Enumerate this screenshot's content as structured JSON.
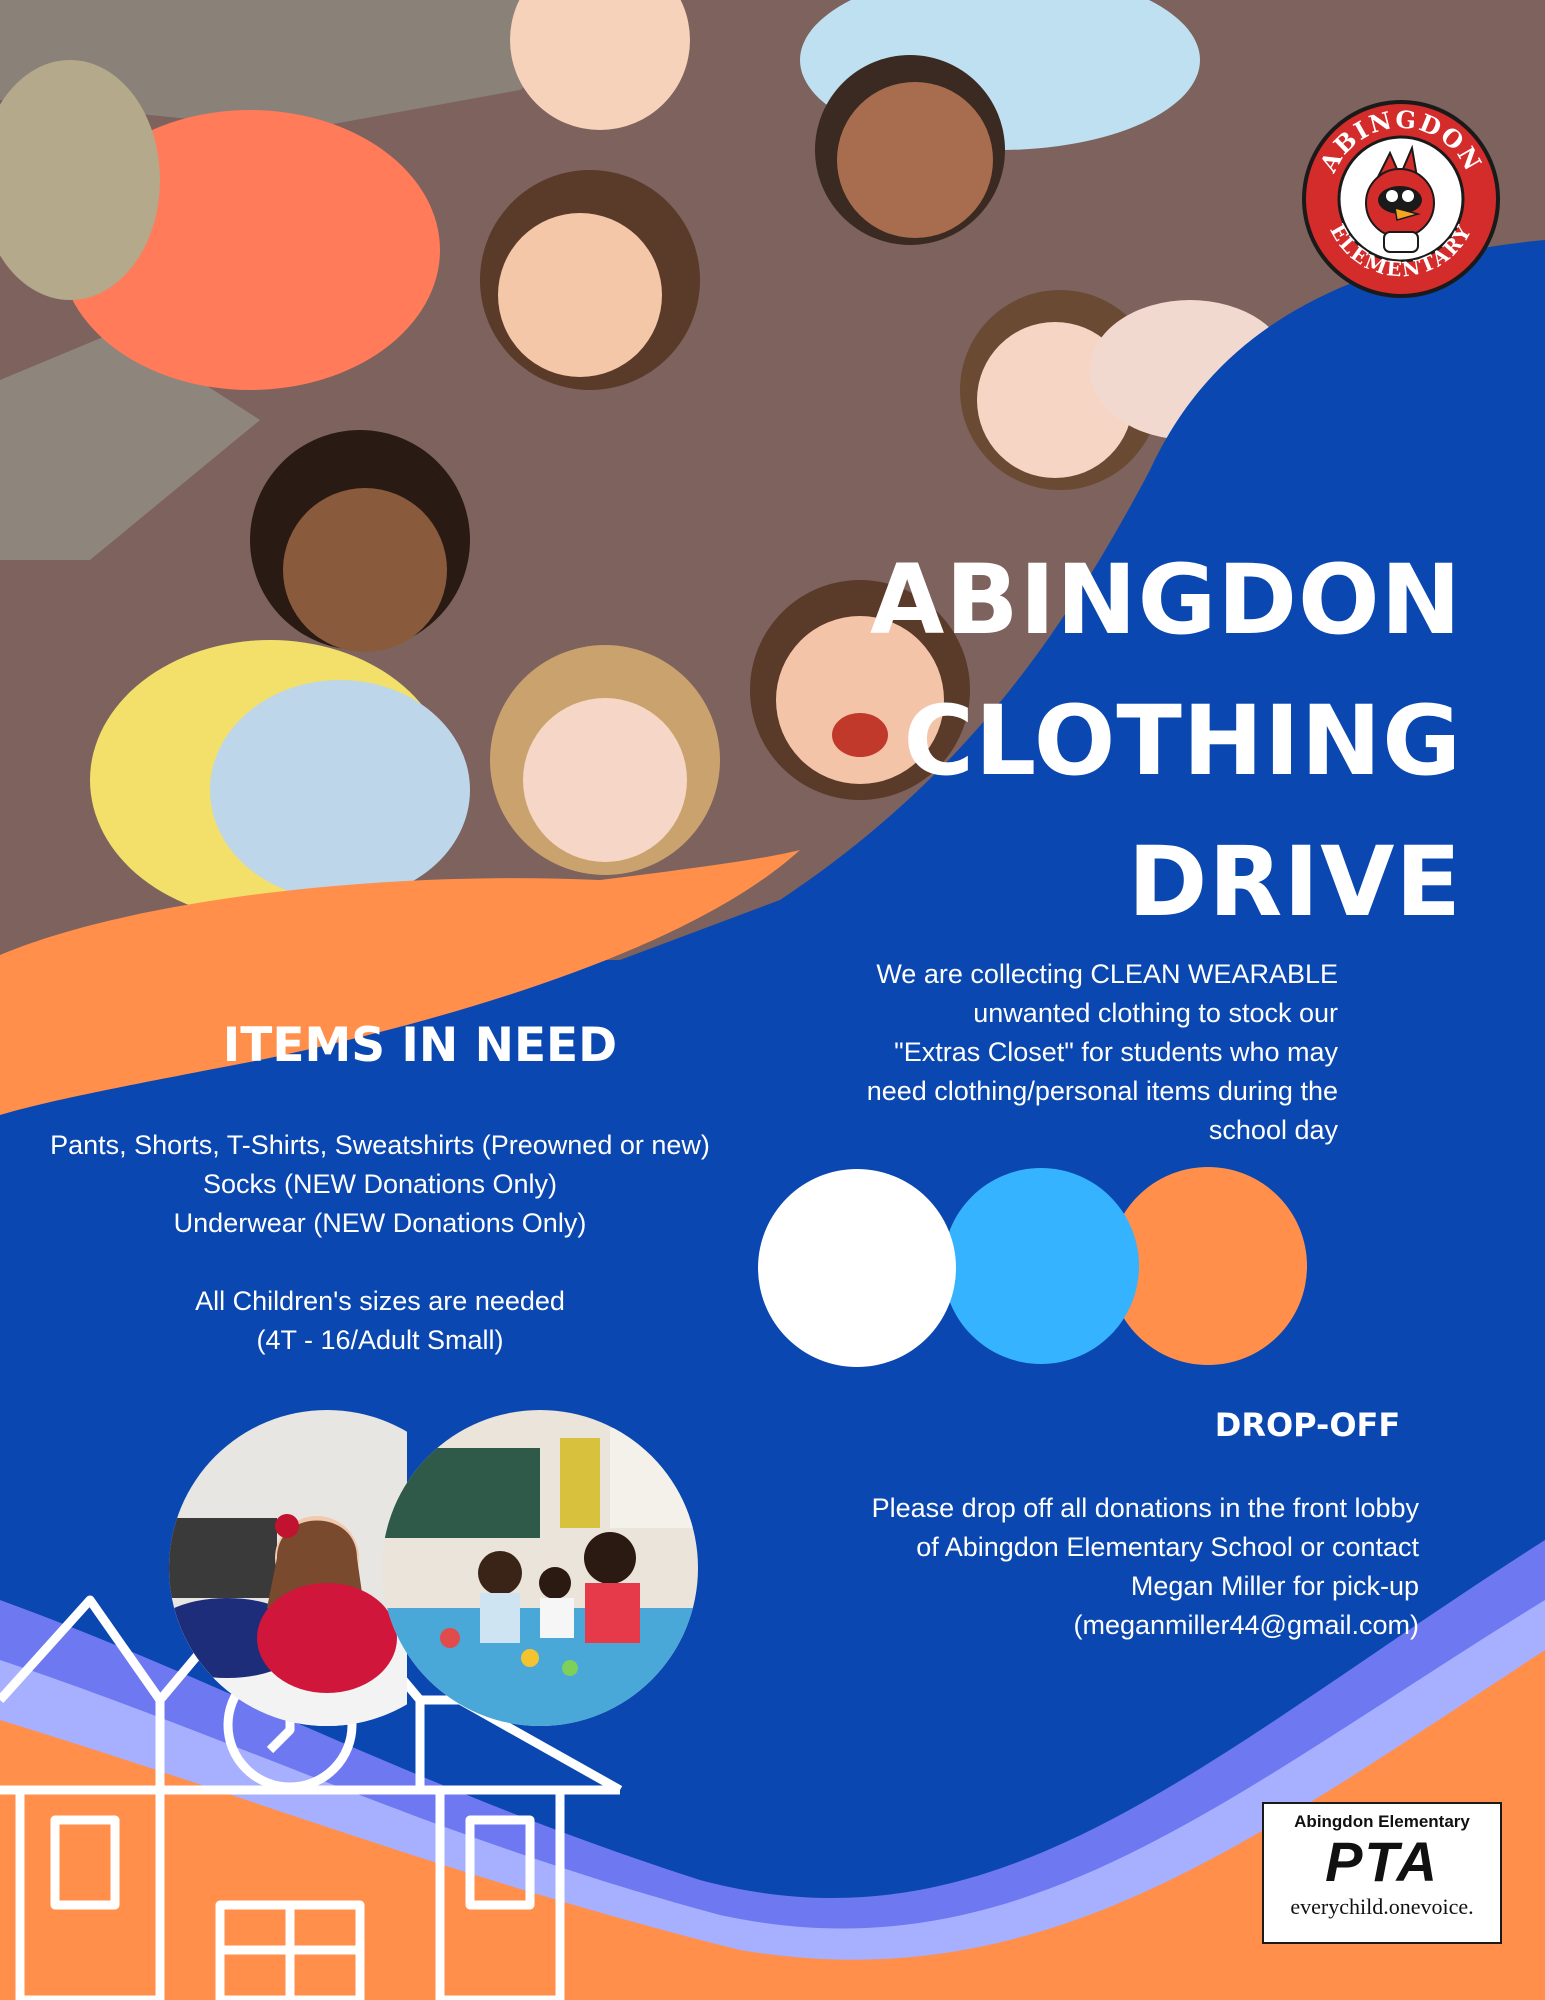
{
  "flyer": {
    "title_lines": [
      "ABINGDON",
      "CLOTHING",
      "DRIVE"
    ],
    "intro_lines": [
      "We are collecting CLEAN WEARABLE",
      "unwanted clothing to stock our",
      "\"Extras Closet\" for students who may",
      "need clothing/personal items during the",
      "school day"
    ],
    "items": {
      "heading": "ITEMS IN NEED",
      "lines": [
        "Pants, Shorts, T-Shirts, Sweatshirts (Preowned or new)",
        "Socks (NEW Donations Only)",
        "Underwear (NEW Donations Only)",
        "",
        "All Children's sizes are needed",
        "(4T - 16/Adult Small)"
      ]
    },
    "dropoff": {
      "heading": "DROP-OFF",
      "lines": [
        "Please drop off all donations in the front lobby",
        "of Abingdon Elementary School or contact",
        "Megan Miller for pick-up",
        "(meganmiller44@gmail.com)"
      ]
    },
    "school_logo": {
      "top_text": "ABINGDON",
      "bottom_text": "ELEMENTARY",
      "icon": "cardinal-mascot-icon"
    },
    "pta_logo": {
      "school": "Abingdon Elementary",
      "mark": "PTA",
      "tagline": "everychild.onevoice."
    },
    "colors": {
      "blue": "#0a47b0",
      "orange": "#ff8f4a",
      "light_blue": "#36b3ff",
      "white": "#ffffff",
      "periwinkle": "#6e78f0",
      "lavender": "#a7b0ff",
      "carpet": "#7d625d",
      "logo_red": "#d42b2b"
    }
  }
}
